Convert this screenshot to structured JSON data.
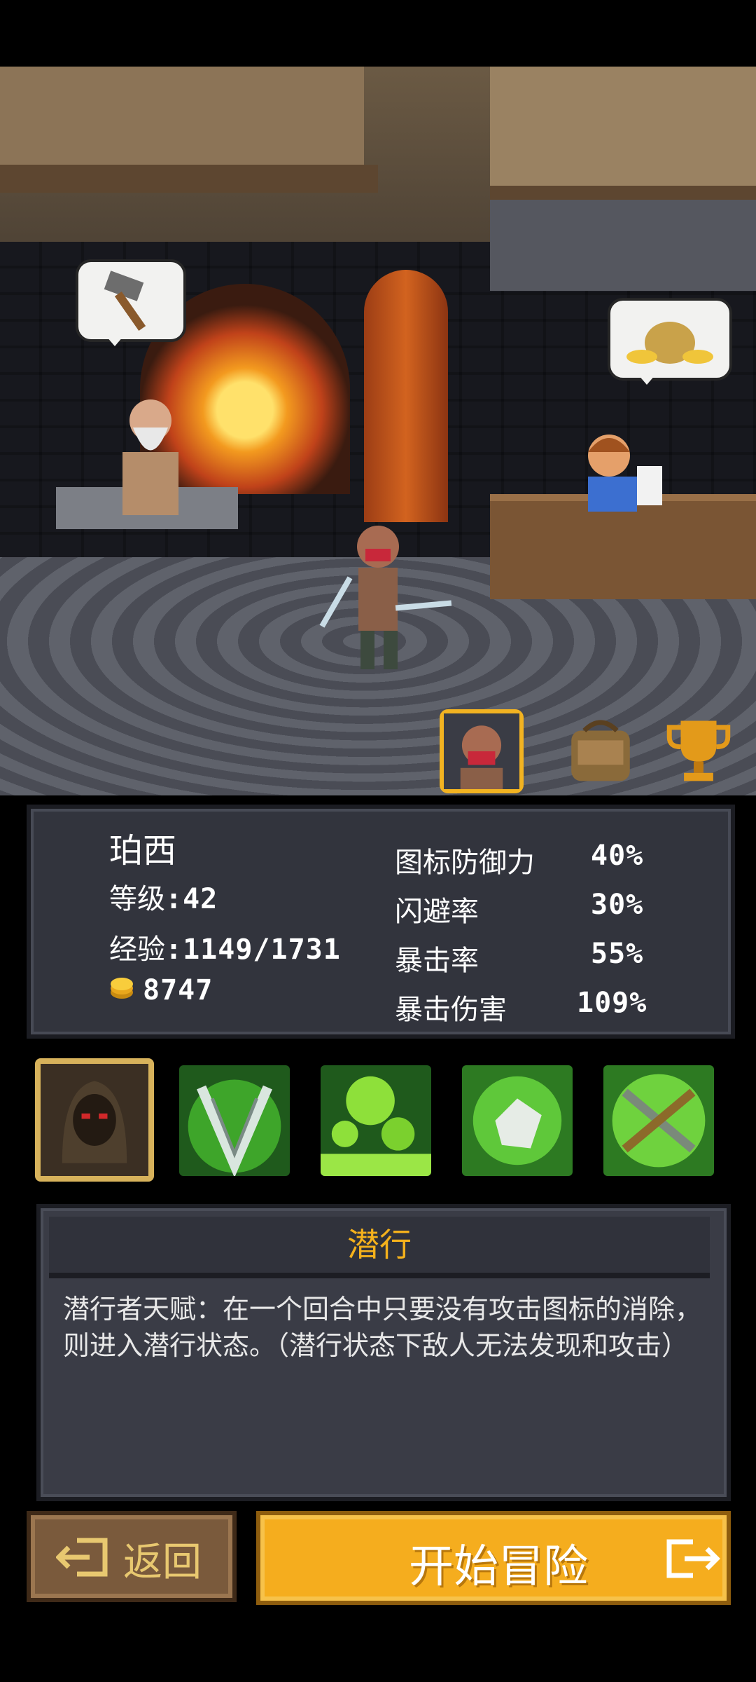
{
  "hero": {
    "name": "珀西",
    "level_label": "等级",
    "level_value": "42",
    "exp_label": "经验",
    "exp_value": "1149/1731",
    "gold_value": "8747"
  },
  "stats": [
    {
      "label": "图标防御力",
      "value": "40%"
    },
    {
      "label": "闪避率",
      "value": "30%"
    },
    {
      "label": "暴击率",
      "value": "55%"
    },
    {
      "label": "暴击伤害",
      "value": "109%"
    }
  ],
  "tabs": [
    "hero-portrait-icon",
    "backpack-icon",
    "trophy-icon"
  ],
  "skills": [
    "hooded-rogue-icon",
    "twin-blades-icon",
    "poison-bubbles-icon",
    "stone-shield-icon",
    "crossed-swords-icon"
  ],
  "description": {
    "title": "潜行",
    "text": "潜行者天赋：在一个回合中只要没有攻击图标的消除，则进入潜行状态。（潜行状态下敌人无法发现和攻击）"
  },
  "buttons": {
    "back": "返回",
    "start": "开始冒险"
  },
  "colors": {
    "accent_gold": "#f4b11c",
    "panel_bg": "#32343d",
    "back_button": "#7a5a3c",
    "start_button": "#f5ad1e"
  }
}
